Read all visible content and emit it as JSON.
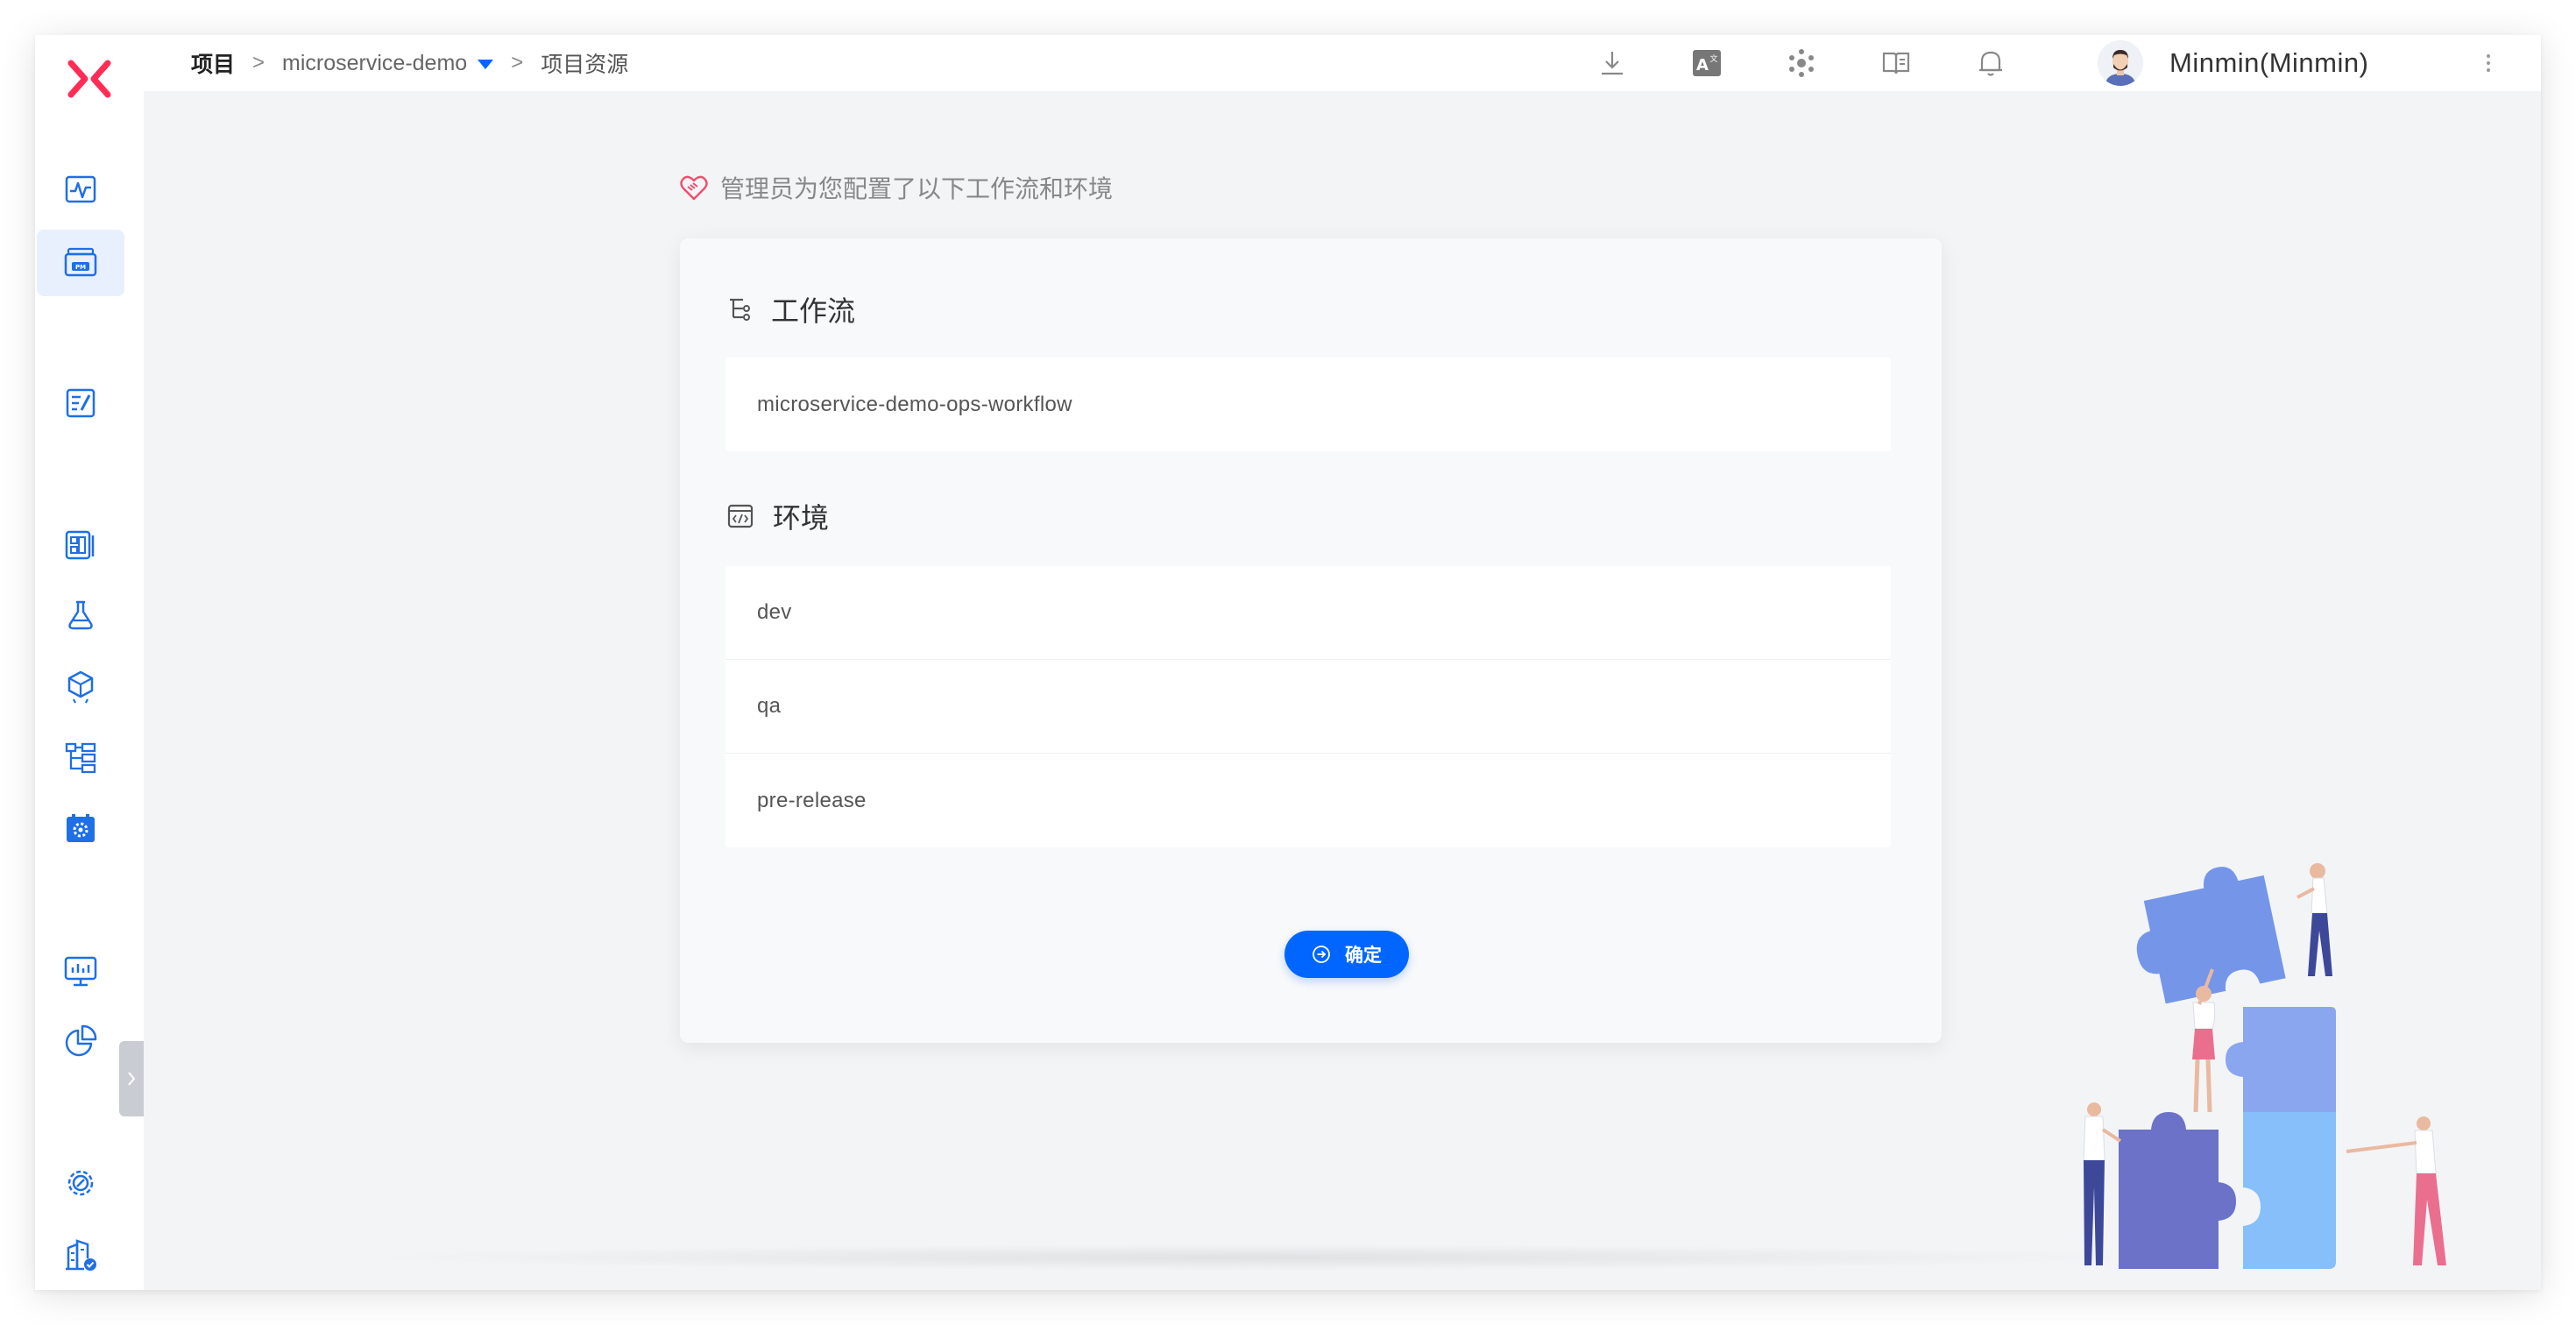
{
  "breadcrumb": {
    "root": "项目",
    "separator": ">",
    "project": "microservice-demo",
    "current": "项目资源"
  },
  "topbar": {
    "icons": [
      "download-icon",
      "translate-icon",
      "plugin-icon",
      "docs-book-icon",
      "bell-icon"
    ],
    "user_name": "Minmin(Minmin)"
  },
  "sidebar": {
    "items": [
      "activity-icon",
      "project-pm-icon",
      "edit-doc-icon",
      "dashboard-panel-icon",
      "test-flask-icon",
      "delivery-package-icon",
      "service-structure-icon",
      "build-settings-icon",
      "monitor-icon",
      "pie-chart-icon",
      "system-settings-icon",
      "enterprise-building-icon"
    ],
    "active_item": "project-pm-icon"
  },
  "main": {
    "notice": "管理员为您配置了以下工作流和环境",
    "workflow_title": "工作流",
    "workflows": [
      "microservice-demo-ops-workflow"
    ],
    "env_title": "环境",
    "environments": [
      "dev",
      "qa",
      "pre-release"
    ],
    "confirm_label": "确定"
  },
  "colors": {
    "accent": "#0066ff",
    "logo": "#ff2d55",
    "background": "#f3f4f6",
    "card": "#f8f9fa"
  }
}
